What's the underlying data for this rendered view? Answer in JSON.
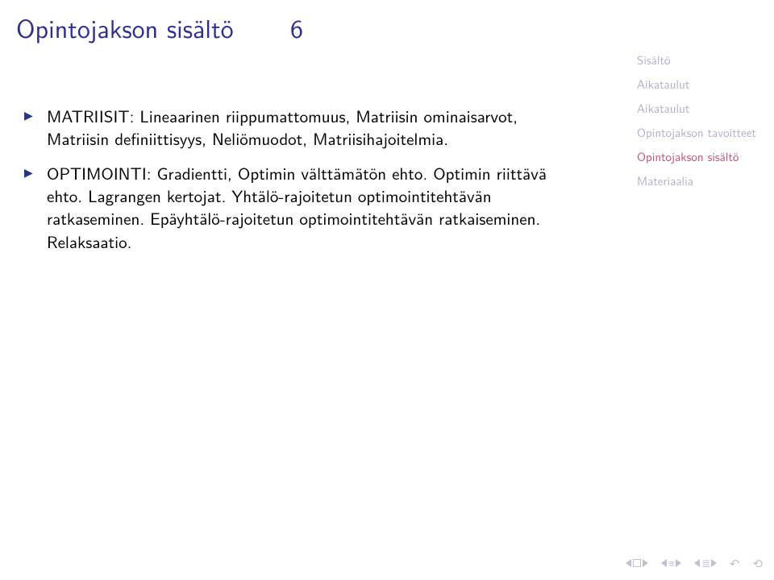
{
  "title": "Opintojakson sisältö",
  "frame_number": "6",
  "sidebar": {
    "items": [
      {
        "label": "Sisältö",
        "class": "dim"
      },
      {
        "label": "Aikataulut",
        "class": "dim"
      },
      {
        "label": "Aikataulut",
        "class": "dim"
      },
      {
        "label": "Opintojakson tavoitteet",
        "class": "dim"
      },
      {
        "label": "Opintojakson sisältö",
        "class": "hl"
      },
      {
        "label": "Materiaalia",
        "class": "dim"
      }
    ]
  },
  "bullets": [
    "MATRIISIT: Lineaarinen riippumattomuus, Matriisin ominaisarvot, Matriisin definiittisyys, Neliömuodot, Matriisihajoitelmia.",
    "OPTIMOINTI: Gradientti, Optimin välttämätön ehto. Optimin riittävä ehto. Lagrangen kertojat. Yhtälö-rajoitetun optimointitehtävän ratkaseminen. Epäyhtälö-rajoitetun optimointitehtävän ratkaiseminen. Relaksaatio."
  ],
  "nav": {
    "prev_slide": "prev-slide",
    "next_slide": "next-slide",
    "prev_section": "prev-section",
    "next_section": "next-section",
    "back": "back",
    "refresh": "refresh"
  }
}
